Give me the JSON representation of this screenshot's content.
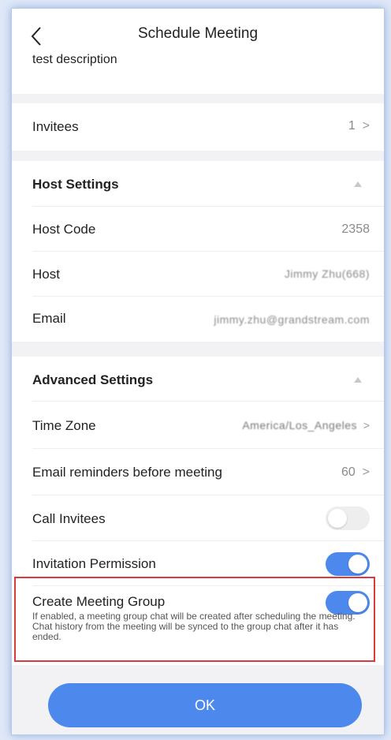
{
  "header": {
    "title": "Schedule Meeting"
  },
  "description": {
    "text": "test description"
  },
  "invitees": {
    "label": "Invitees",
    "count": "1"
  },
  "host_settings": {
    "title": "Host Settings",
    "host_code": {
      "label": "Host Code",
      "value": "2358"
    },
    "host": {
      "label": "Host",
      "value": "Jimmy Zhu(668)"
    },
    "email": {
      "label": "Email",
      "value": "jimmy.zhu@grandstream.com"
    }
  },
  "advanced_settings": {
    "title": "Advanced Settings",
    "time_zone": {
      "label": "Time Zone",
      "value": "America/Los_Angeles"
    },
    "email_reminders": {
      "label": "Email reminders before meeting",
      "value": "60"
    },
    "call_invitees": {
      "label": "Call Invitees",
      "enabled": false
    },
    "invitation_permission": {
      "label": "Invitation Permission",
      "enabled": true
    },
    "create_meeting_group": {
      "label": "Create Meeting Group",
      "enabled": true,
      "help": "If enabled, a meeting group chat will be created after scheduling the meeting. Chat history from the meeting will be synced to the group chat after it has ended."
    }
  },
  "footer": {
    "ok_label": "OK"
  },
  "colors": {
    "accent": "#4d89ec",
    "highlight": "#d93a3a"
  }
}
